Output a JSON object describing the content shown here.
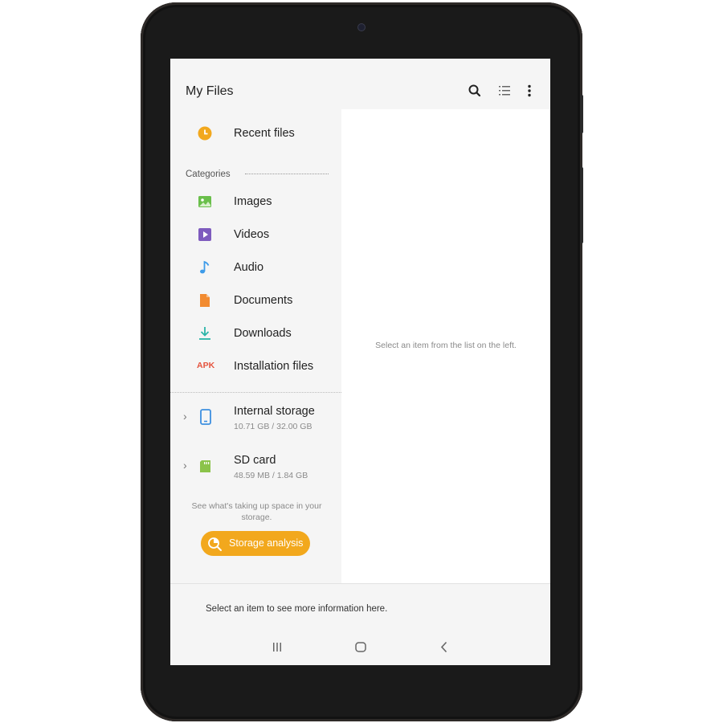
{
  "app": {
    "title": "My Files"
  },
  "toolbar": {
    "search_icon": "search-icon",
    "list_view_icon": "list-view-icon",
    "more_icon": "more-options-icon"
  },
  "sidebar": {
    "recent": {
      "label": "Recent files",
      "icon": "clock-icon"
    },
    "categories_header": "Categories",
    "categories": [
      {
        "label": "Images",
        "icon": "image-icon",
        "color": "#6abf4b"
      },
      {
        "label": "Videos",
        "icon": "video-icon",
        "color": "#7e5bbe"
      },
      {
        "label": "Audio",
        "icon": "music-note-icon",
        "color": "#3d9be9"
      },
      {
        "label": "Documents",
        "icon": "document-icon",
        "color": "#f28b30"
      },
      {
        "label": "Downloads",
        "icon": "download-icon",
        "color": "#2bb5a8"
      },
      {
        "label": "Installation files",
        "icon": "apk-icon",
        "icon_text": "APK",
        "color": "#e5533d"
      }
    ],
    "storage": [
      {
        "name": "Internal storage",
        "usage": "10.71 GB / 32.00 GB",
        "icon": "phone-icon"
      },
      {
        "name": "SD card",
        "usage": "48.59 MB / 1.84 GB",
        "icon": "sd-card-icon"
      }
    ],
    "hint": "See what's taking up space in your storage.",
    "analysis_button": "Storage analysis"
  },
  "detail": {
    "empty_message": "Select an item from the list on the left."
  },
  "info_panel": {
    "message": "Select an item to see more information here."
  },
  "navbar": {
    "recents": "recents-icon",
    "home": "home-icon",
    "back": "back-icon"
  },
  "colors": {
    "accent": "#f2a81d",
    "bezel": "#1a1a1a",
    "screen_bg": "#f5f5f5"
  }
}
